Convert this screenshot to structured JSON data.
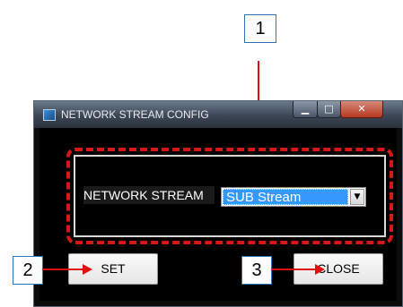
{
  "window": {
    "title": "NETWORK STREAM CONFIG",
    "minimize_glyph": "▁",
    "maximize_glyph": "□",
    "close_glyph": "✕"
  },
  "form": {
    "label": "NETWORK STREAM",
    "selected_value": "SUB Stream",
    "dropdown_glyph": "▼"
  },
  "buttons": {
    "set_label": "SET",
    "close_label": "CLOSE"
  },
  "callouts": {
    "one": "1",
    "two": "2",
    "three": "3"
  },
  "colors": {
    "highlight": "#d81818",
    "arrow": "#e01010",
    "selection": "#3399ff",
    "callout_border": "#2e74b5"
  }
}
